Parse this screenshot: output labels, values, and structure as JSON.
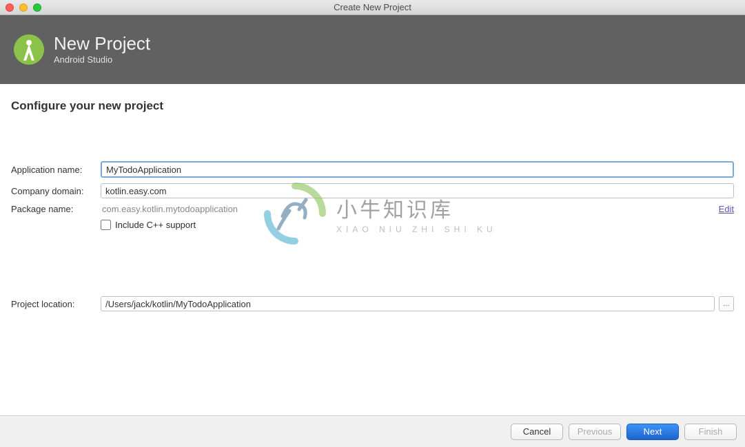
{
  "window": {
    "title": "Create New Project"
  },
  "header": {
    "title": "New Project",
    "subtitle": "Android Studio"
  },
  "main": {
    "section_title": "Configure your new project",
    "labels": {
      "app_name": "Application name:",
      "company_domain": "Company domain:",
      "package_name": "Package name:",
      "project_location": "Project location:"
    },
    "values": {
      "app_name": "MyTodoApplication",
      "company_domain": "kotlin.easy.com",
      "package_name": "com.easy.kotlin.mytodoapplication",
      "project_location": "/Users/jack/kotlin/MyTodoApplication"
    },
    "edit_link": "Edit",
    "cpp_checkbox_label": "Include C++ support",
    "browse_glyph": "…"
  },
  "footer": {
    "cancel": "Cancel",
    "previous": "Previous",
    "next": "Next",
    "finish": "Finish"
  },
  "watermark": {
    "cn": "小牛知识库",
    "pinyin": "XIAO NIU ZHI SHI KU"
  }
}
